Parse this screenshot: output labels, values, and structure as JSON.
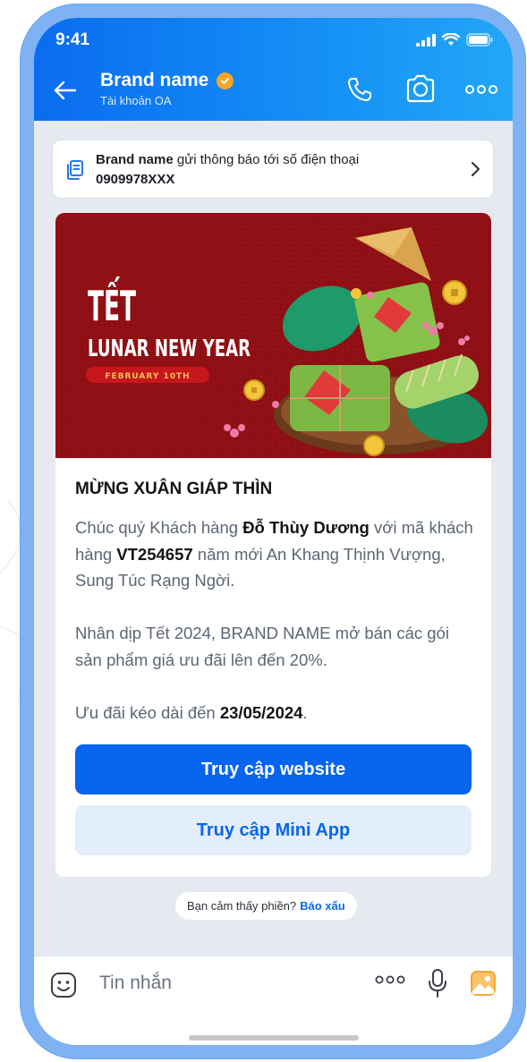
{
  "status": {
    "time": "9:41"
  },
  "header": {
    "brand_name": "Brand name",
    "subtitle": "Tài khoản OA"
  },
  "notice": {
    "brand": "Brand name",
    "text": " gửi thông báo tới số điện thoại",
    "phone": "0909978XXX"
  },
  "banner": {
    "line1": "TẾT",
    "line2": "LUNAR NEW YEAR",
    "date": "FEBRUARY 10TH"
  },
  "message": {
    "title": "MỪNG XUÂN GIÁP THÌN",
    "p1_a": "Chúc quý Khách hàng ",
    "p1_name": "Đỗ Thùy Dương",
    "p1_b": " với mã khách hàng ",
    "p1_code": "VT254657",
    "p1_c": " năm mới An Khang Thịnh Vượng, Sung Túc Rạng Ngời.",
    "p2": "Nhân dịp Tết 2024, BRAND NAME mở bán các gói sản phẩm giá ưu đãi lên đến 20%.",
    "p3_a": "Ưu đãi kéo dài đến ",
    "p3_date": "23/05/2024",
    "p3_b": ".",
    "btn_website": "Truy cập website",
    "btn_miniapp": "Truy cập Mini App"
  },
  "report": {
    "question": "Bạn cảm thấy phiền?",
    "action": "Báo xấu"
  },
  "input": {
    "placeholder": "Tin nhắn"
  },
  "colors": {
    "primary": "#0865f0",
    "banner_red": "#8e0f14",
    "accent_orange": "#f6a623"
  }
}
